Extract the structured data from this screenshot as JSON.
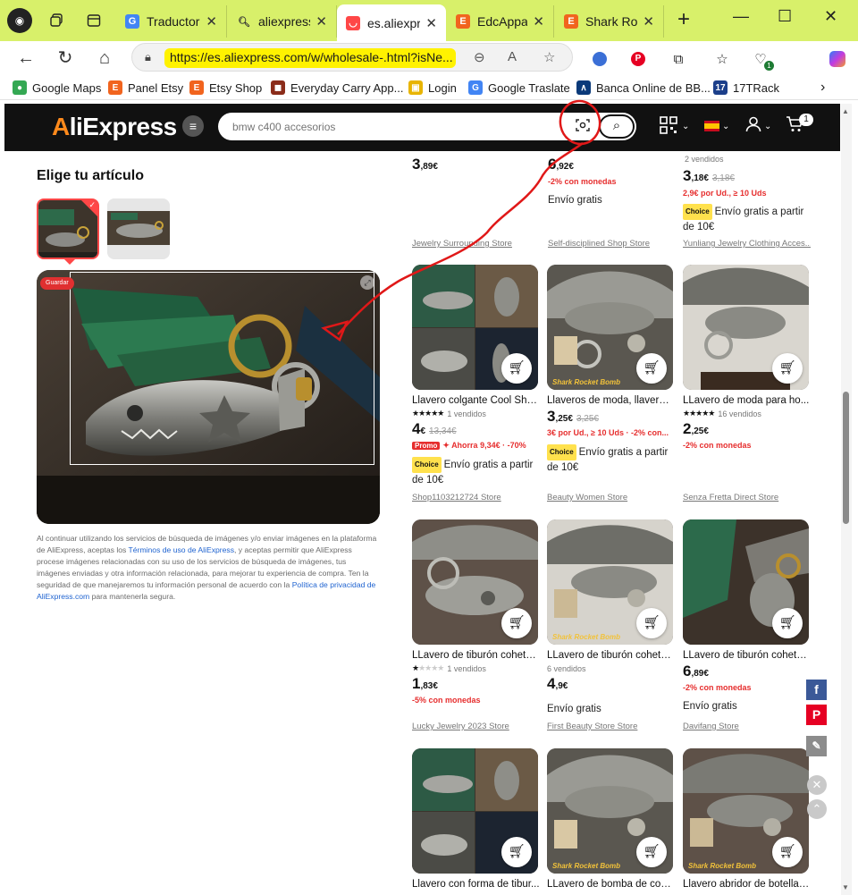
{
  "browser": {
    "tabs": [
      {
        "title": "Traductor de",
        "favicon": "google-translate-icon"
      },
      {
        "title": "aliexpress -",
        "favicon": "search-icon"
      },
      {
        "title": "es.aliexpress",
        "favicon": "aliexpress-icon",
        "active": true
      },
      {
        "title": "EdcApparat",
        "favicon": "etsy-icon"
      },
      {
        "title": "Shark Rock",
        "favicon": "etsy-icon"
      }
    ],
    "url": "https://es.aliexpress.com/w/wholesale-.html?isNe...",
    "bookmarks": [
      {
        "label": "Google Maps"
      },
      {
        "label": "Panel Etsy"
      },
      {
        "label": "Etsy Shop"
      },
      {
        "label": "Everyday Carry App..."
      },
      {
        "label": "Login"
      },
      {
        "label": "Google Traslate"
      },
      {
        "label": "Banca Online de BB..."
      },
      {
        "label": "17TRack"
      }
    ],
    "extension_badge": "1"
  },
  "aliexpress": {
    "logo": "AliExpress",
    "search_placeholder": "bmw c400 accesorios",
    "cart_count": "1"
  },
  "left_panel": {
    "title": "Elige tu artículo",
    "photo_badge": "Guardar",
    "legal_1": "Al continuar utilizando los servicios de búsqueda de imágenes y/o enviar imágenes en la plataforma de AliExpress, aceptas los ",
    "legal_link_1": "Términos de uso de AliExpress",
    "legal_2": ", y aceptas permitir que AliExpress procese imágenes relacionadas con su uso de los servicios de búsqueda de imágenes, tus imágenes enviadas y otra información relacionada, para mejorar tu experiencia de compra. Ten la seguridad de que manejaremos tu información personal de acuerdo con la ",
    "legal_link_2": "Política de privacidad de AliExpress.com",
    "legal_3": " para mantenerla segura."
  },
  "top_row": [
    {
      "price_int": "3",
      "price_dec": ",89€",
      "store": "Jewelry Surrounding Store"
    },
    {
      "price_int": "6",
      "price_dec": ",92€",
      "discount": "-2% con monedas",
      "shipping": "Envío gratis",
      "store": "Self-disciplined Shop Store"
    },
    {
      "sold": "2 vendidos",
      "price_int": "3",
      "price_dec": ",18€",
      "old_price": "3,18€",
      "discount": "2,9€ por Ud., ≥ 10 Uds",
      "choice": "Choice",
      "shipping": "Envío gratis a partir de 10€",
      "store": "Yunliang Jewelry Clothing Acces..."
    }
  ],
  "products": [
    {
      "title": "Llavero colgante Cool Shar...",
      "rating": 5,
      "sold": "1 vendidos",
      "price_int": "4",
      "price_dec": "€",
      "old_price": "13,34€",
      "promo": "Promo",
      "discount": "Ahorra 9,34€ · -70%",
      "choice": "Choice",
      "shipping": "Envío gratis a partir de 10€",
      "store": "Shop1103212724 Store"
    },
    {
      "title": "Llaveros de moda, llavero ...",
      "rating": 0,
      "sold": "",
      "price_int": "3",
      "price_dec": ",25€",
      "old_price": "3,25€",
      "discount": "3€ por Ud., ≥ 10 Uds · -2% con...",
      "choice": "Choice",
      "shipping": "Envío gratis a partir de 10€",
      "store": "Beauty Women Store"
    },
    {
      "title": "LLavero de moda para ho...",
      "rating": 5,
      "sold": "16 vendidos",
      "price_int": "2",
      "price_dec": ",25€",
      "old_price": "",
      "discount": "-2% con monedas",
      "choice": "",
      "shipping": "",
      "store": "Senza Fretta Direct Store"
    },
    {
      "title": "LLavero de tiburón cohete ...",
      "rating": 1,
      "sold": "1 vendidos",
      "price_int": "1",
      "price_dec": ",83€",
      "old_price": "",
      "discount": "-5% con monedas",
      "choice": "",
      "shipping": "",
      "store": "Lucky Jewelry 2023 Store"
    },
    {
      "title": "LLavero de tiburón cohete ...",
      "rating": 0,
      "sold": "6 vendidos",
      "price_int": "4",
      "price_dec": ",9€",
      "old_price": "",
      "discount": "",
      "choice": "",
      "shipping": "Envío gratis",
      "store": "First Beauty Store Store"
    },
    {
      "title": "LLavero de tiburón cohete ...",
      "rating": 0,
      "sold": "",
      "price_int": "6",
      "price_dec": ",89€",
      "old_price": "",
      "discount": "-2% con monedas",
      "choice": "",
      "shipping": "Envío gratis",
      "store": "Davifang Store"
    },
    {
      "title": "Llavero con forma de tibur...",
      "store": ""
    },
    {
      "title": "LLavero de bomba de cohe...",
      "store": ""
    },
    {
      "title": "Llavero abridor de botellas...",
      "store": ""
    }
  ],
  "image_overlay_text": "Shark Rocket Bomb",
  "colors": {
    "accent": "#ff4747",
    "price_red": "#e62e2e",
    "tabbar": "#d8f06a",
    "highlight": "#fff200",
    "annotation": "#e01818"
  }
}
